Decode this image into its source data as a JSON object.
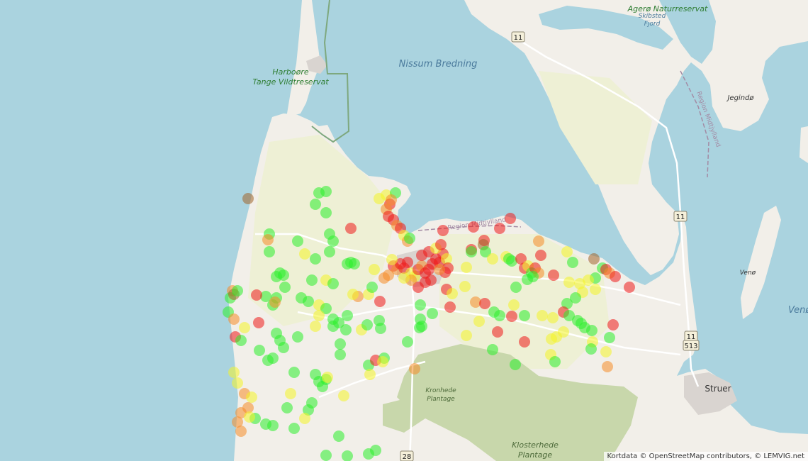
{
  "map": {
    "colors": {
      "sea": "#aad3df",
      "land": "#f2efe9",
      "farmland": "#eef0d5",
      "forest": "#c8d7ab",
      "town": "#d9d4d0",
      "road": "#ffffff",
      "reserve": "#7ea87e",
      "boundary": "#a38ba4",
      "green": "#2cee2c",
      "yellow": "#f4f428",
      "orange": "#f58c28",
      "red": "#ee1a1a",
      "brown": "#a0642a"
    },
    "labels": {
      "sea": "Nissum Bredning",
      "reserve_line1": "Harboøre",
      "reserve_line2": "Tange Vildtreservat",
      "nature_line1": "Agerø Naturreservat",
      "skibsted_line1": "Skibsted",
      "skibsted_line2": "Fjord",
      "island": "Jegindø",
      "region": "Region Midtjylland",
      "region2": "Region Midtjylland",
      "town": "Struer",
      "forest1_line1": "Kronhede",
      "forest1_line2": "Plantage",
      "forest2_line1": "Klosterhede",
      "forest2_line2": "Plantage",
      "venoe": "Venø",
      "venoe_right": "Venø"
    },
    "road_shields": [
      "11",
      "11",
      "11",
      "513",
      "28"
    ],
    "attribution": "Kortdata © OpenStreetMap contributors, © LEMVIG.net"
  }
}
